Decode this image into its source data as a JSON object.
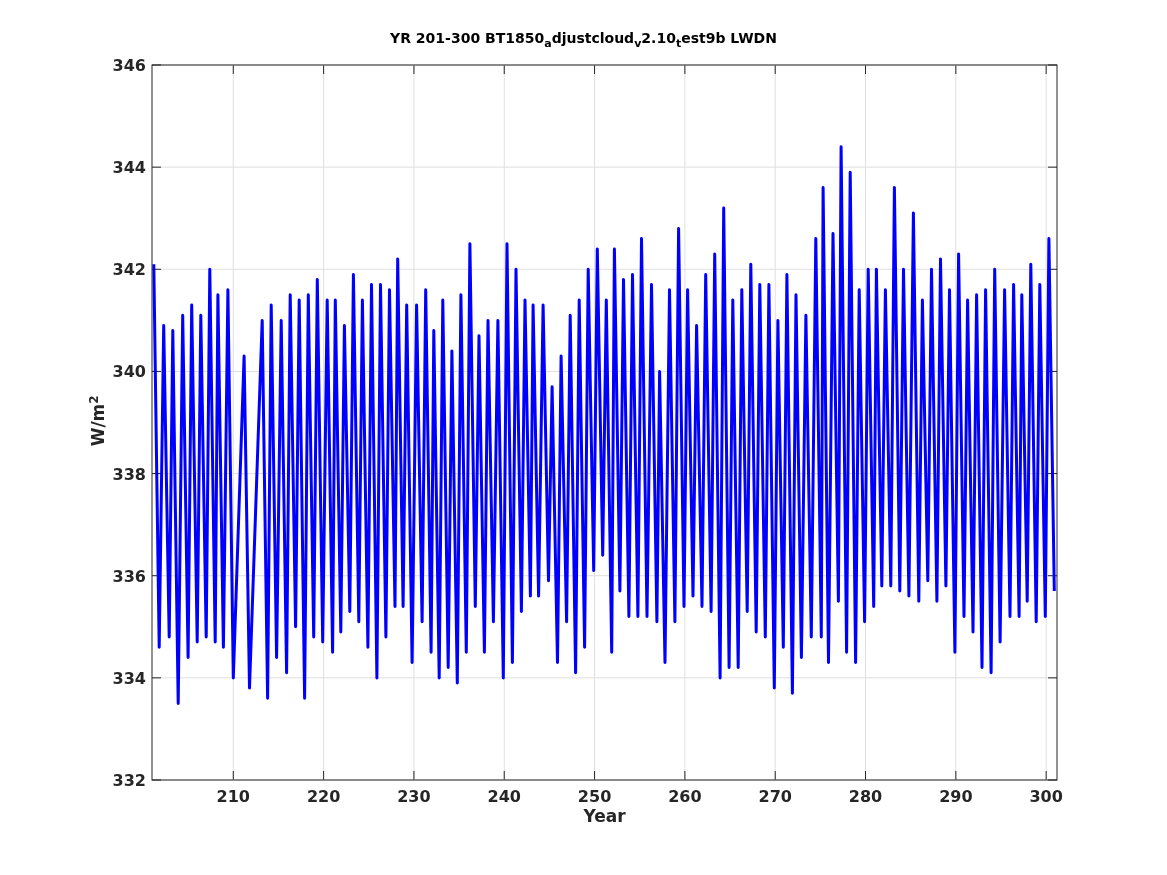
{
  "figure": {
    "chart_data": {
      "type": "line",
      "title": "YR 201-300 BT1850$_{a}$djustcloud$_{v}$2.10$_{t}$est9b LWDN",
      "xlabel": "Year",
      "ylabel": "W/m$^{2}$",
      "xlim": [
        201,
        301.2
      ],
      "ylim": [
        332,
        346
      ],
      "grid": true,
      "xticks": [
        210,
        220,
        230,
        240,
        250,
        260,
        270,
        280,
        290,
        300
      ],
      "yticks": [
        332,
        334,
        336,
        338,
        340,
        342,
        344,
        346
      ],
      "x": [
        201.2,
        201.8,
        202.3,
        202.9,
        203.3,
        203.9,
        204.4,
        205.0,
        205.4,
        206.0,
        206.4,
        207.0,
        207.4,
        208.0,
        208.3,
        208.9,
        209.4,
        210.0,
        211.2,
        211.8,
        213.2,
        213.8,
        214.2,
        214.8,
        215.3,
        215.9,
        216.3,
        216.9,
        217.3,
        217.9,
        218.3,
        218.9,
        219.3,
        219.9,
        220.4,
        221.0,
        221.3,
        221.9,
        222.3,
        222.9,
        223.3,
        223.9,
        224.3,
        224.9,
        225.3,
        225.9,
        226.3,
        226.9,
        227.3,
        227.9,
        228.2,
        228.8,
        229.2,
        229.8,
        230.3,
        230.9,
        231.3,
        231.9,
        232.2,
        232.8,
        233.2,
        233.8,
        234.2,
        234.8,
        235.2,
        235.8,
        236.2,
        236.8,
        237.2,
        237.8,
        238.2,
        238.8,
        239.3,
        239.9,
        240.3,
        240.9,
        241.3,
        241.9,
        242.3,
        242.9,
        243.2,
        243.8,
        244.3,
        244.9,
        245.3,
        245.9,
        246.3,
        246.9,
        247.3,
        247.9,
        248.3,
        248.9,
        249.3,
        249.9,
        250.3,
        250.9,
        251.3,
        251.9,
        252.2,
        252.8,
        253.2,
        253.8,
        254.2,
        254.8,
        255.2,
        255.8,
        256.3,
        256.9,
        257.2,
        257.8,
        258.3,
        258.9,
        259.3,
        259.9,
        260.3,
        260.9,
        261.3,
        261.9,
        262.3,
        262.9,
        263.3,
        263.9,
        264.3,
        264.9,
        265.3,
        265.9,
        266.3,
        266.9,
        267.3,
        267.9,
        268.3,
        268.9,
        269.3,
        269.9,
        270.3,
        270.9,
        271.3,
        271.9,
        272.3,
        272.9,
        273.4,
        274.0,
        274.5,
        275.1,
        275.3,
        275.9,
        276.4,
        277.0,
        277.3,
        277.9,
        278.3,
        278.9,
        279.3,
        279.9,
        280.3,
        280.9,
        281.2,
        281.8,
        282.2,
        282.8,
        283.2,
        283.8,
        284.2,
        284.8,
        285.3,
        285.9,
        286.3,
        286.9,
        287.3,
        287.9,
        288.3,
        288.9,
        289.3,
        289.9,
        290.3,
        290.9,
        291.3,
        291.9,
        292.3,
        292.9,
        293.3,
        293.9,
        294.3,
        294.9,
        295.4,
        296.0,
        296.4,
        297.0,
        297.3,
        297.9,
        298.3,
        298.9,
        299.3,
        299.9,
        300.3,
        300.9
      ],
      "series": [
        {
          "color": "#0000ff",
          "values": [
            342.1,
            334.6,
            340.9,
            334.8,
            340.8,
            333.5,
            341.1,
            334.4,
            341.3,
            334.7,
            341.1,
            334.8,
            342.0,
            334.7,
            341.5,
            334.6,
            341.6,
            334.0,
            340.3,
            333.8,
            341.0,
            333.6,
            341.3,
            334.4,
            341.0,
            334.1,
            341.5,
            335.0,
            341.4,
            333.6,
            341.5,
            334.8,
            341.8,
            334.7,
            341.4,
            334.5,
            341.4,
            334.9,
            340.9,
            335.3,
            341.9,
            335.1,
            341.4,
            334.6,
            341.7,
            334.0,
            341.7,
            334.8,
            341.6,
            335.4,
            342.2,
            335.4,
            341.3,
            334.3,
            341.3,
            335.1,
            341.6,
            334.5,
            340.8,
            334.0,
            341.4,
            334.2,
            340.4,
            333.9,
            341.5,
            334.5,
            342.5,
            335.4,
            340.7,
            334.5,
            341.0,
            335.1,
            341.0,
            334.0,
            342.5,
            334.3,
            342.0,
            335.3,
            341.4,
            335.6,
            341.3,
            335.6,
            341.3,
            335.9,
            339.7,
            334.3,
            340.3,
            335.1,
            341.1,
            334.1,
            341.4,
            334.6,
            342.0,
            336.1,
            342.4,
            336.4,
            341.4,
            334.5,
            342.4,
            335.7,
            341.8,
            335.2,
            341.9,
            335.2,
            342.6,
            335.2,
            341.7,
            335.1,
            340.0,
            334.3,
            341.6,
            335.1,
            342.8,
            335.4,
            341.6,
            335.6,
            340.9,
            335.4,
            341.9,
            335.3,
            342.3,
            334.0,
            343.2,
            334.2,
            341.4,
            334.2,
            341.6,
            335.3,
            342.1,
            334.9,
            341.7,
            334.8,
            341.7,
            333.8,
            341.0,
            334.6,
            341.9,
            333.7,
            341.5,
            334.4,
            341.1,
            334.8,
            342.6,
            334.8,
            343.6,
            334.3,
            342.7,
            335.5,
            344.4,
            334.5,
            343.9,
            334.3,
            341.6,
            335.1,
            342.0,
            335.4,
            342.0,
            335.8,
            341.6,
            335.8,
            343.6,
            335.7,
            342.0,
            335.6,
            343.1,
            335.5,
            341.4,
            335.9,
            342.0,
            335.5,
            342.2,
            335.8,
            341.6,
            334.5,
            342.3,
            335.2,
            341.4,
            334.9,
            341.5,
            334.2,
            341.6,
            334.1,
            342.0,
            334.7,
            341.6,
            335.2,
            341.7,
            335.2,
            341.5,
            335.5,
            342.1,
            335.1,
            341.7,
            335.2,
            342.6,
            335.7
          ]
        }
      ]
    }
  }
}
